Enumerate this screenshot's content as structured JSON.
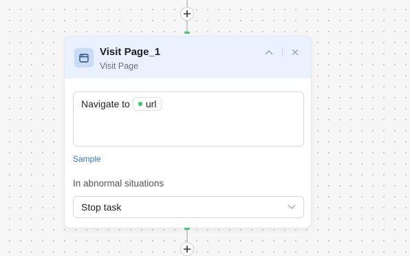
{
  "node": {
    "title": "Visit Page_1",
    "subtitle": "Visit Page",
    "header_bg": "#e8f1fd",
    "icon": "browser-window-icon",
    "actions": {
      "collapse_icon": "chevron-up-icon",
      "close_icon": "close-icon"
    }
  },
  "instruction": {
    "prefix": "Navigate to",
    "variable": {
      "name": "url",
      "dot_color": "#2fc95d"
    }
  },
  "sample_link": "Sample",
  "abnormal": {
    "label": "In abnormal situations",
    "selected": "Stop task",
    "dropdown_icon": "chevron-down-icon"
  },
  "connectors": {
    "add_icon": "plus-icon",
    "port_color": "#3ccf6e"
  }
}
